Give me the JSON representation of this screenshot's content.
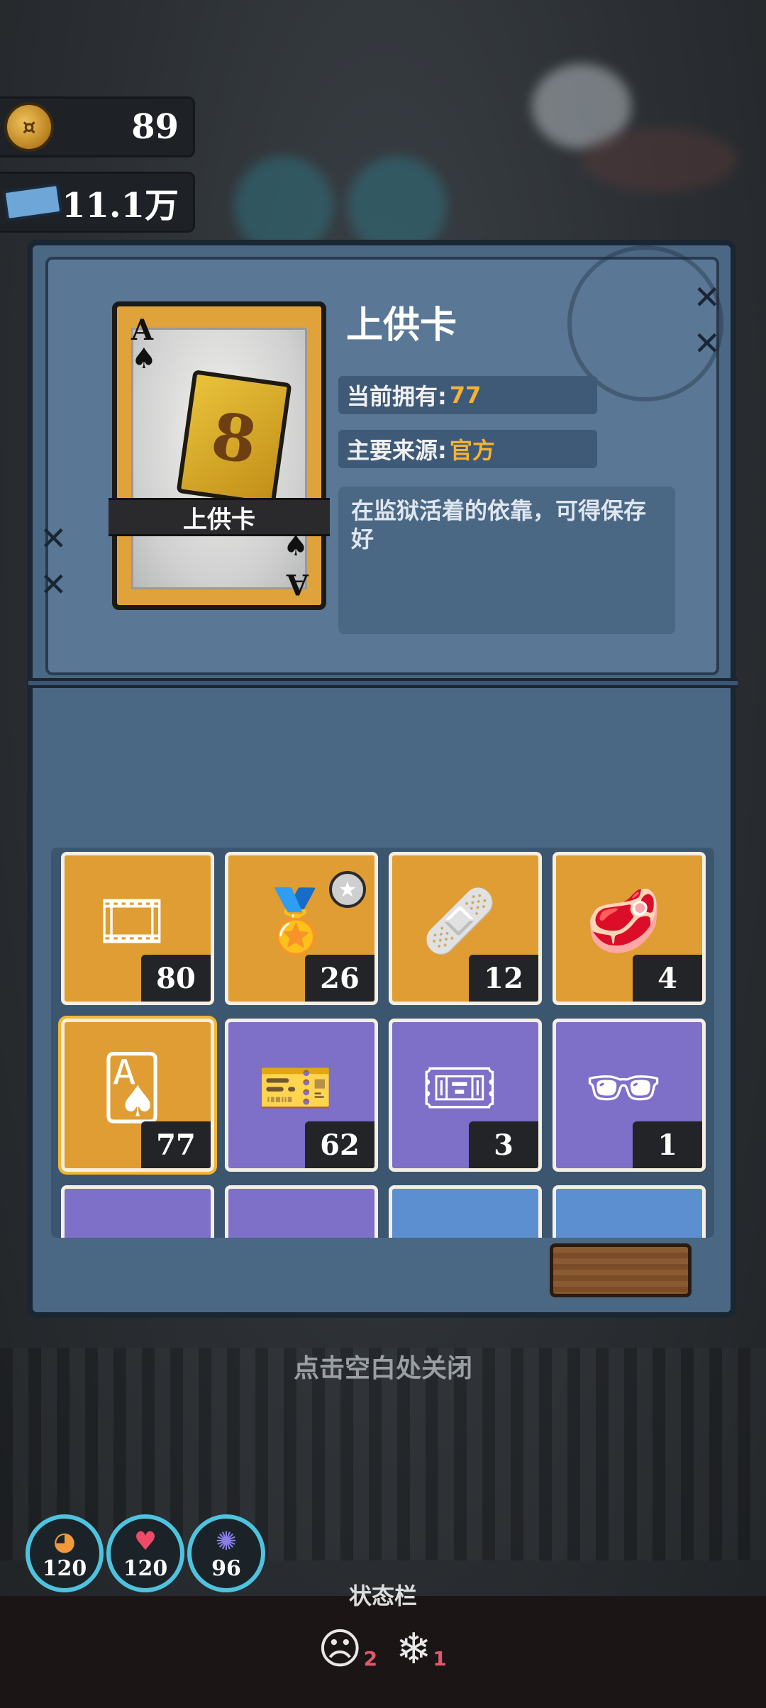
{
  "currency": {
    "coins": "89",
    "tickets": "11.1万"
  },
  "item": {
    "name": "上供卡",
    "card_rank": "A",
    "card_suit": "♠",
    "card_banner": "上供卡",
    "owned_label": "当前拥有:",
    "owned_value": "77",
    "source_label": "主要来源:",
    "source_value": "官方",
    "description": "在监狱活着的依靠，可得保存好"
  },
  "inventory": {
    "slots": [
      {
        "name": "film-reel",
        "icon": "🎞",
        "count": "80",
        "color": "orange"
      },
      {
        "name": "gold-badge",
        "icon": "🏅",
        "count": "26",
        "color": "orange"
      },
      {
        "name": "medical-card",
        "icon": "🩹",
        "count": "12",
        "color": "orange"
      },
      {
        "name": "steak-poster",
        "icon": "🥩",
        "count": "4",
        "color": "orange"
      },
      {
        "name": "tribute-card",
        "icon": "🂡",
        "count": "77",
        "color": "orange",
        "selected": true
      },
      {
        "name": "toy-ticket",
        "icon": "🎫",
        "count": "62",
        "color": "purple"
      },
      {
        "name": "blue-coupon",
        "icon": "🎟",
        "count": "3",
        "color": "purple"
      },
      {
        "name": "sunglasses-card",
        "icon": "🕶",
        "count": "1",
        "color": "purple"
      }
    ]
  },
  "close_hint": "点击空白处关闭",
  "stats": {
    "hunger": {
      "value": "120",
      "icon": "◕"
    },
    "health": {
      "value": "120",
      "icon": "♥"
    },
    "brain": {
      "value": "96",
      "icon": "✺"
    }
  },
  "status_bar": {
    "title": "状态栏",
    "mood_count": "2",
    "cold_count": "1"
  },
  "colors": {
    "accent": "#f3b334",
    "panel": "#4a6784",
    "stat_ring": "#4ec3e0"
  }
}
